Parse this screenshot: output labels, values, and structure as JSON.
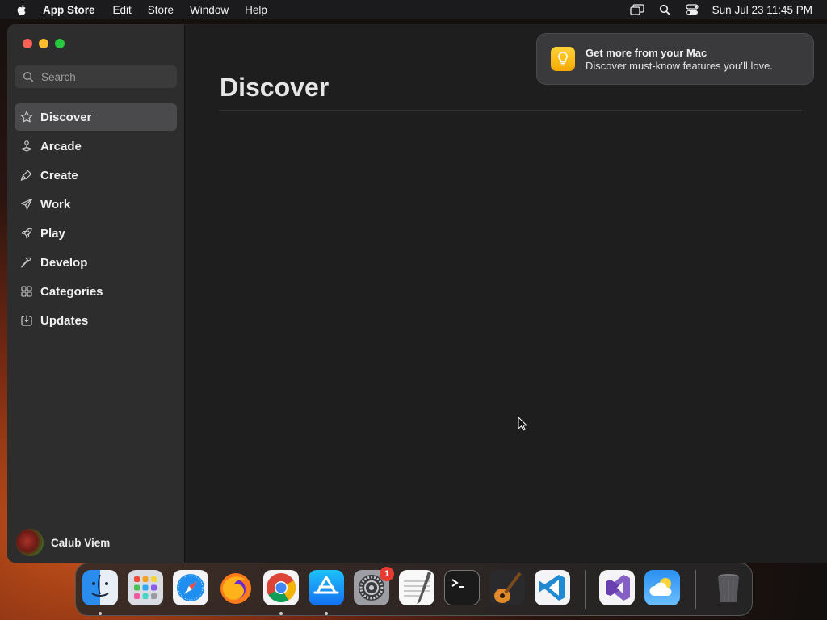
{
  "menubar": {
    "app_name": "App Store",
    "menus": [
      "Edit",
      "Store",
      "Window",
      "Help"
    ],
    "clock": "Sun Jul 23  11:45 PM"
  },
  "sidebar": {
    "search_placeholder": "Search",
    "items": [
      {
        "label": "Discover",
        "icon": "star-icon",
        "active": true
      },
      {
        "label": "Arcade",
        "icon": "joystick-icon"
      },
      {
        "label": "Create",
        "icon": "brush-icon"
      },
      {
        "label": "Work",
        "icon": "paper-plane-icon"
      },
      {
        "label": "Play",
        "icon": "rocket-icon"
      },
      {
        "label": "Develop",
        "icon": "hammer-icon"
      },
      {
        "label": "Categories",
        "icon": "grid-icon"
      },
      {
        "label": "Updates",
        "icon": "download-icon"
      }
    ],
    "user_name": "Calub Viem"
  },
  "main": {
    "title": "Discover"
  },
  "notification": {
    "title": "Get more from your Mac",
    "body": "Discover must-know features you’ll love."
  },
  "dock": {
    "apps": [
      "finder",
      "launchpad",
      "safari",
      "firefox",
      "chrome",
      "app-store",
      "system-settings",
      "textedit",
      "terminal",
      "garageband",
      "vscode",
      "visual-studio",
      "weather",
      "trash"
    ],
    "system_settings_badge": "1"
  },
  "colors": {
    "accent_yellow": "#f5a900",
    "close": "#fe5f57",
    "minimize": "#febc2e",
    "maximize": "#28c840"
  }
}
